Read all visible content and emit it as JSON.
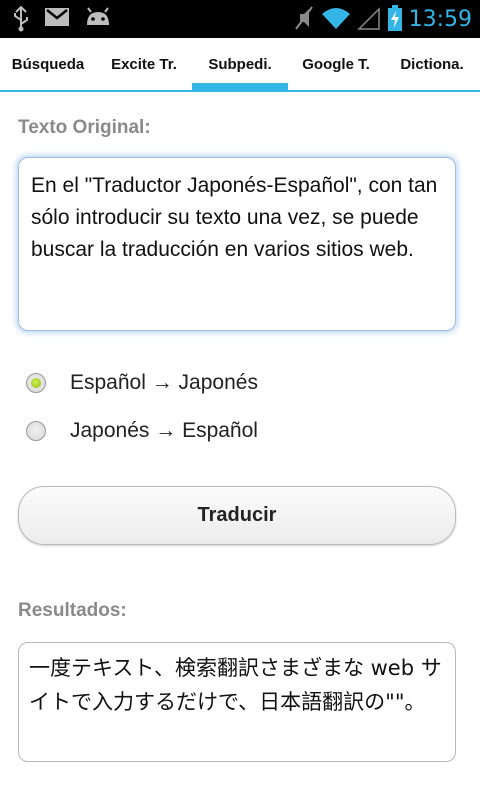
{
  "status_bar": {
    "time": "13:59",
    "left_icons": [
      "usb-icon",
      "gmail-icon",
      "android-icon"
    ],
    "right_icons": [
      "mute-icon",
      "wifi-icon",
      "signal-icon",
      "battery-charging-icon"
    ]
  },
  "tabs": [
    {
      "label": "Búsqueda",
      "active": false
    },
    {
      "label": "Excite Tr.",
      "active": false
    },
    {
      "label": "Subpedi.",
      "active": true
    },
    {
      "label": "Google T.",
      "active": false
    },
    {
      "label": "Dictiona.",
      "active": false
    }
  ],
  "original": {
    "label": "Texto Original:",
    "text": "En el \"Traductor Japonés-Español\", con tan sólo introducir su texto una vez, se puede buscar la traducción en varios sitios web."
  },
  "direction": {
    "options": [
      {
        "label": "Español → Japonés",
        "checked": true
      },
      {
        "label": "Japonés → Español",
        "checked": false
      }
    ]
  },
  "translate_button": {
    "label": "Traducir"
  },
  "results": {
    "label": "Resultados:",
    "text": "一度テキスト、検索翻訳さまざまな web サイトで入力するだけで、日本語翻訳の\"\"。"
  },
  "colors": {
    "accent": "#33b5e5",
    "radio_checked": "#99cc00",
    "label_gray": "#8a8a8a"
  }
}
